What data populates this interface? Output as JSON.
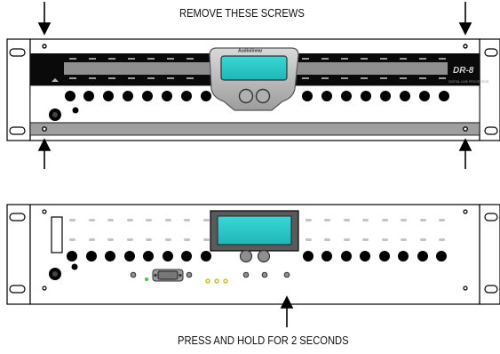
{
  "instructions": {
    "top_caption": "REMOVE THESE SCREWS",
    "bottom_caption": "PRESS AND HOLD FOR 2 SECONDS"
  },
  "device": {
    "logo": "DR-8",
    "sublabel": "DIGITAL LINE PROCESSOR",
    "brand": "Audiolinear"
  }
}
